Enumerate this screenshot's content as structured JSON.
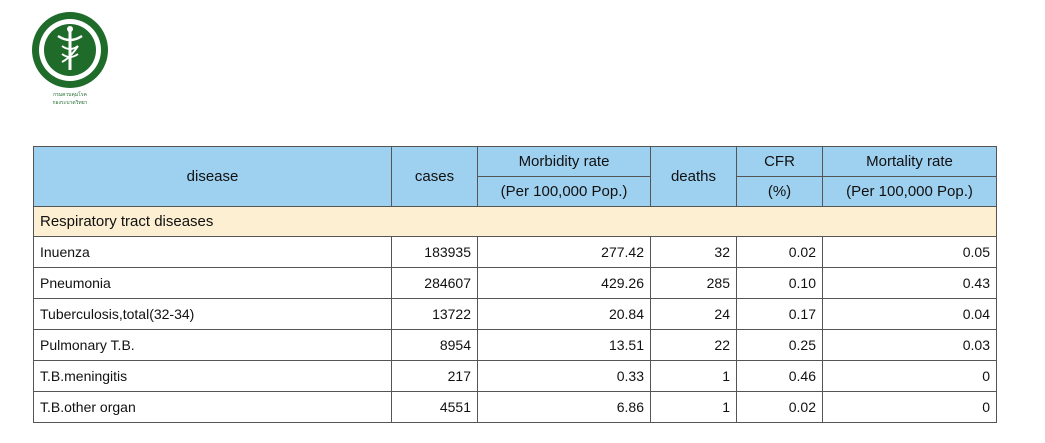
{
  "logo": {
    "emblem": "ministry-of-public-health-seal-icon",
    "lines": [
      "กรมควบคุมโรค",
      "กองระบาดวิทยา"
    ],
    "colors": {
      "green": "#1f6b2a",
      "white": "#ffffff"
    }
  },
  "table": {
    "headers": {
      "disease": "disease",
      "cases": "cases",
      "morbidity": "Morbidity rate",
      "morbidity_unit": "(Per 100,000 Pop.)",
      "deaths": "deaths",
      "cfr": "CFR",
      "cfr_unit": "(%)",
      "mortality": "Mortality rate",
      "mortality_unit": "(Per 100,000 Pop.)"
    },
    "section_title": "Respiratory tract diseases",
    "rows": [
      {
        "disease": "Inuenza",
        "cases": "183935",
        "morbidity": "277.42",
        "deaths": "32",
        "cfr": "0.02",
        "mortality": "0.05"
      },
      {
        "disease": "Pneumonia",
        "cases": "284607",
        "morbidity": "429.26",
        "deaths": "285",
        "cfr": "0.10",
        "mortality": "0.43"
      },
      {
        "disease": "Tuberculosis,total(32-34)",
        "cases": "13722",
        "morbidity": "20.84",
        "deaths": "24",
        "cfr": "0.17",
        "mortality": "0.04"
      },
      {
        "disease": "Pulmonary T.B.",
        "cases": "8954",
        "morbidity": "13.51",
        "deaths": "22",
        "cfr": "0.25",
        "mortality": "0.03"
      },
      {
        "disease": "T.B.meningitis",
        "cases": "217",
        "morbidity": "0.33",
        "deaths": "1",
        "cfr": "0.46",
        "mortality": "0"
      },
      {
        "disease": "T.B.other organ",
        "cases": "4551",
        "morbidity": "6.86",
        "deaths": "1",
        "cfr": "0.02",
        "mortality": "0"
      }
    ],
    "colors": {
      "header_bg": "#9ed0f0",
      "section_bg": "#fcefd2",
      "border": "#555555"
    }
  }
}
